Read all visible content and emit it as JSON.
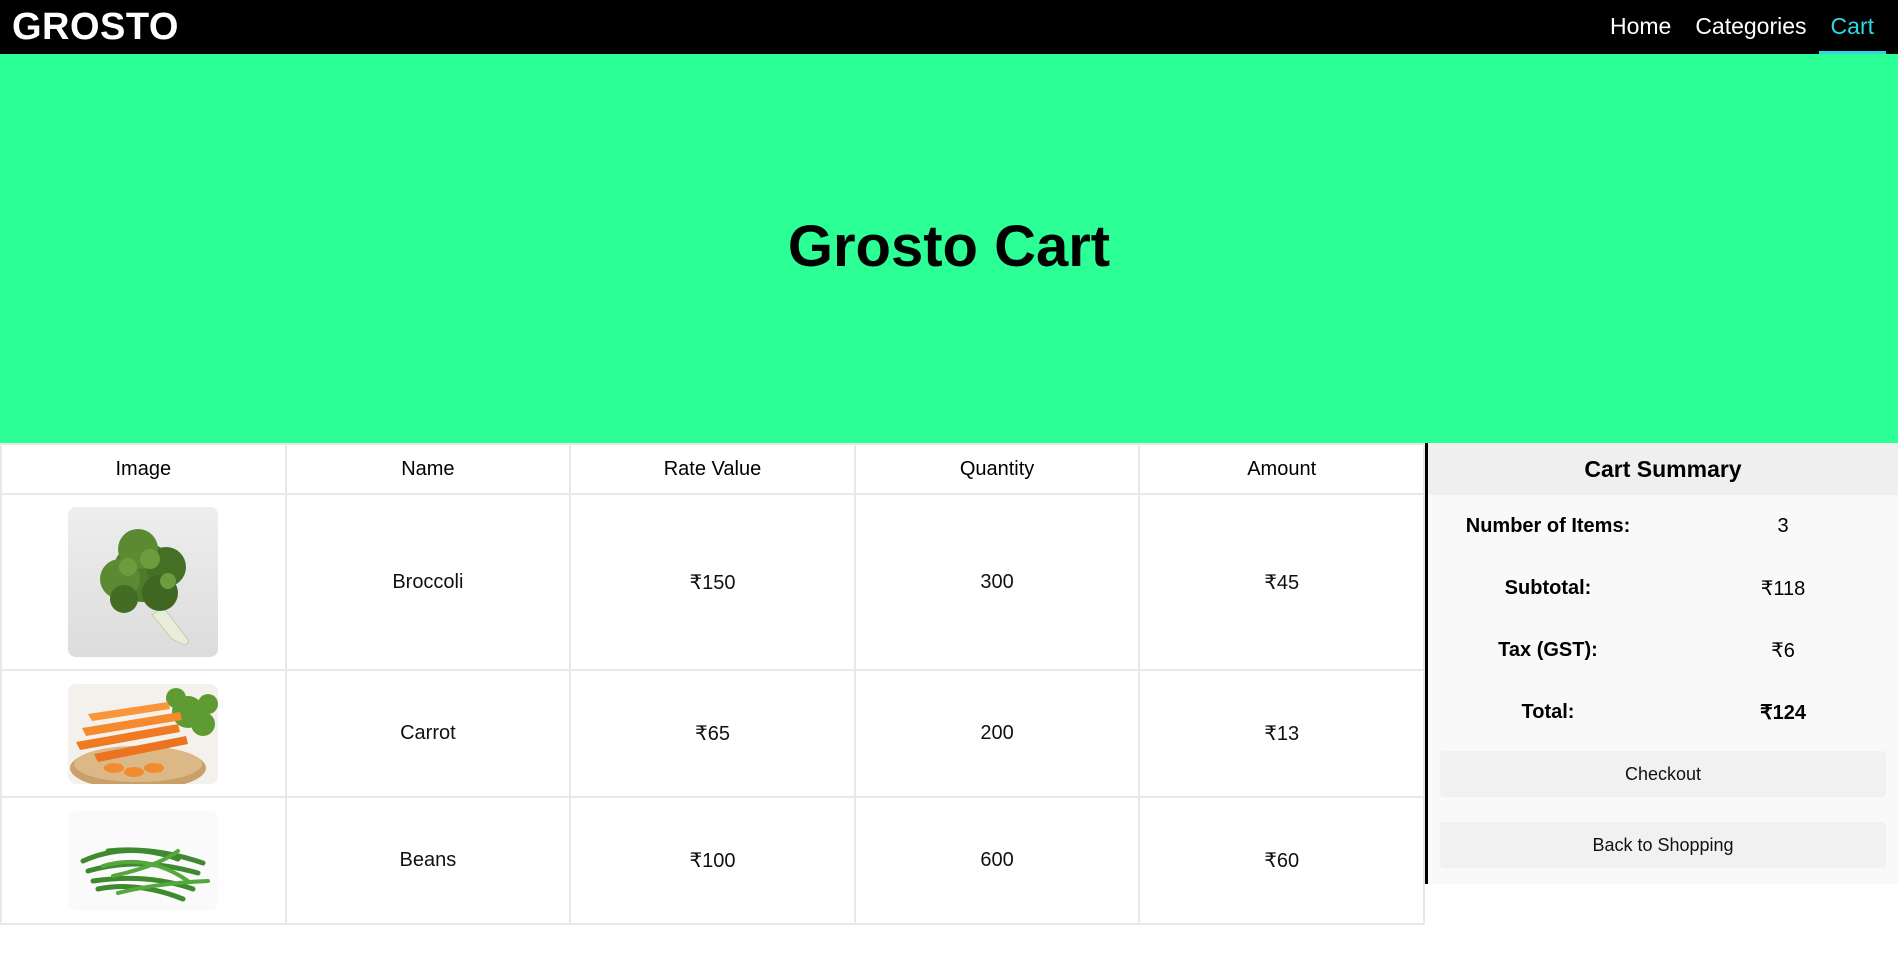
{
  "navbar": {
    "brand": "GROSTO",
    "links": [
      "Home",
      "Categories",
      "Cart"
    ],
    "active_link": "Cart",
    "active_color": "#2ed6e6"
  },
  "hero": {
    "title": "Grosto Cart",
    "background": "#2bff95"
  },
  "cart_table": {
    "headers": [
      "Image",
      "Name",
      "Rate Value",
      "Quantity",
      "Amount"
    ],
    "rows": [
      {
        "image": "broccoli-image",
        "name": "Broccoli",
        "rate": "₹150",
        "quantity": "300",
        "amount": "₹45"
      },
      {
        "image": "carrot-image",
        "name": "Carrot",
        "rate": "₹65",
        "quantity": "200",
        "amount": "₹13"
      },
      {
        "image": "beans-image",
        "name": "Beans",
        "rate": "₹100",
        "quantity": "600",
        "amount": "₹60"
      }
    ]
  },
  "summary": {
    "title": "Cart Summary",
    "items_label": "Number of Items:",
    "items_value": "3",
    "subtotal_label": "Subtotal:",
    "subtotal_value": "₹118",
    "tax_label": "Tax (GST):",
    "tax_value": "₹6",
    "total_label": "Total:",
    "total_value": "₹124",
    "checkout_label": "Checkout",
    "back_label": "Back to Shopping"
  }
}
